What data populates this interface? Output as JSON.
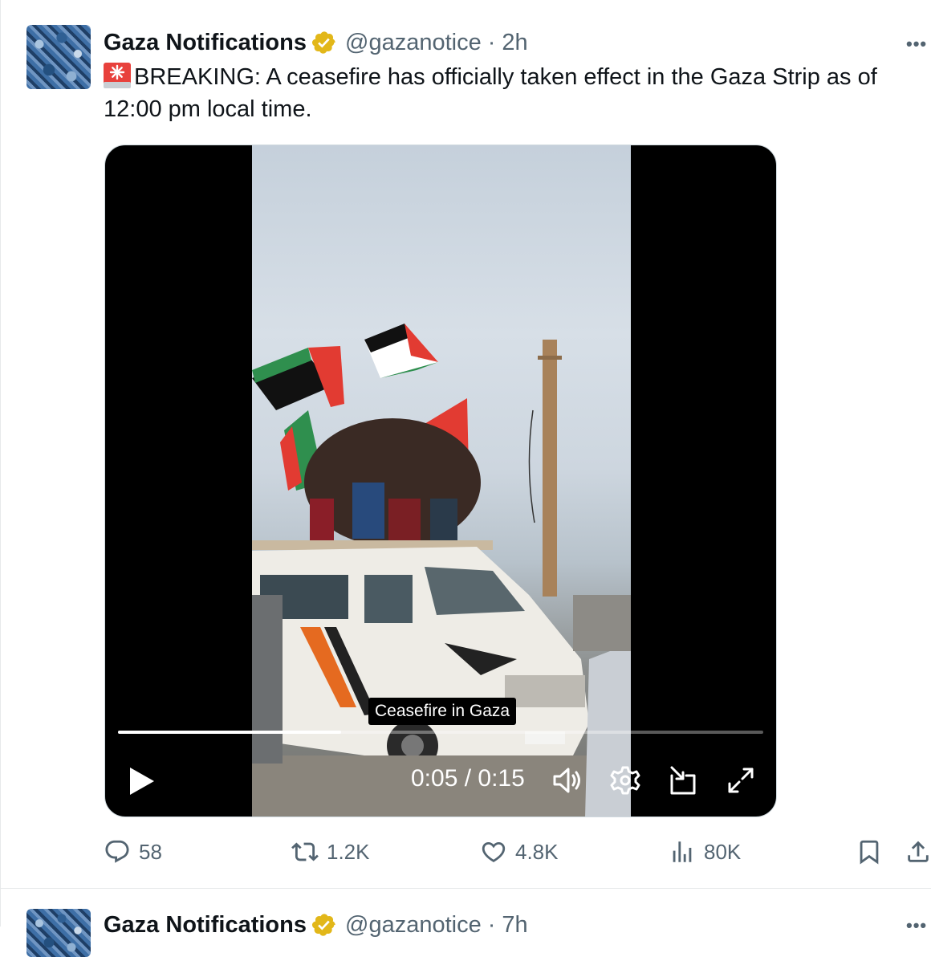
{
  "tweet": {
    "author_name": "Gaza Notifications",
    "handle": "@gazanotice",
    "separator": "·",
    "time_ago": "2h",
    "more": "•••",
    "text": "BREAKING: A ceasefire has officially taken effect in the Gaza Strip as of 12:00 pm local time.",
    "video": {
      "caption": "Ceasefire in Gaza",
      "time_display": "0:05 / 0:15",
      "progress": 0.346
    },
    "actions": {
      "replies": "58",
      "reposts": "1.2K",
      "likes": "4.8K",
      "views": "80K"
    }
  },
  "next_tweet": {
    "author_name": "Gaza Notifications",
    "handle": "@gazanotice",
    "separator": "·",
    "time_ago": "7h",
    "more": "•••"
  },
  "colors": {
    "text_primary": "#0f1419",
    "text_secondary": "#536471",
    "verified_gold": "#e2b719",
    "siren_red": "#e8413c",
    "divider": "#e7e9ea"
  },
  "icons": [
    "verified-badge-icon",
    "siren-icon",
    "more-icon",
    "play-icon",
    "volume-icon",
    "settings-gear-icon",
    "pip-icon",
    "fullscreen-icon",
    "reply-icon",
    "repost-icon",
    "like-icon",
    "views-icon",
    "bookmark-icon",
    "share-icon"
  ]
}
